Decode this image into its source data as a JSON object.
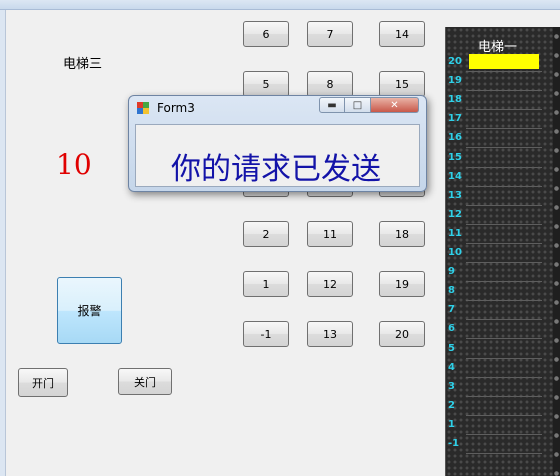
{
  "form": {
    "elevator_title": "电梯三",
    "current_floor": "10",
    "alarm_label": "报警",
    "open_label": "开门",
    "close_label": "关门"
  },
  "floor_buttons": {
    "col1": [
      "6",
      "5",
      "2",
      "1",
      "-1"
    ],
    "col2": [
      "7",
      "8",
      "11",
      "12",
      "13"
    ],
    "col3": [
      "14",
      "15",
      "18",
      "19",
      "20"
    ]
  },
  "shaft": {
    "title": "电梯一",
    "floors": [
      "20",
      "19",
      "18",
      "17",
      "16",
      "15",
      "14",
      "13",
      "12",
      "11",
      "10",
      "9",
      "8",
      "7",
      "6",
      "5",
      "4",
      "3",
      "2",
      "1",
      "-1"
    ],
    "car_color": "#ffff00",
    "label_color": "#2fd0e8"
  },
  "dialog": {
    "title": "Form3",
    "message": "你的请求已发送",
    "message_color": "#1313a8"
  },
  "colors": {
    "floor_number": "#e00000"
  }
}
